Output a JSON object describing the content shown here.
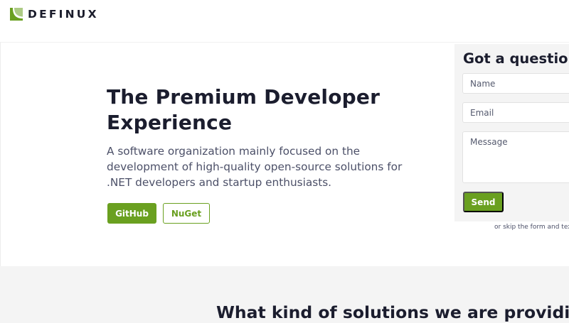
{
  "brand": {
    "name": "DEFINUX",
    "logo_icon": "definux-logo-icon",
    "accent_color": "#6aa020"
  },
  "hero": {
    "title": "The Premium Developer Experience",
    "subtitle": "A software organization mainly focused on the development of high-quality open-source solutions for .NET developers and startup enthusiasts.",
    "buttons": {
      "github_label": "GitHub",
      "nuget_label": "NuGet"
    }
  },
  "contact_form": {
    "title": "Got a question?",
    "name_placeholder": "Name",
    "email_placeholder": "Email",
    "message_placeholder": "Message",
    "send_label": "Send",
    "skip_text": "or skip the form and text"
  },
  "solutions": {
    "title": "What kind of solutions we are providing?"
  }
}
